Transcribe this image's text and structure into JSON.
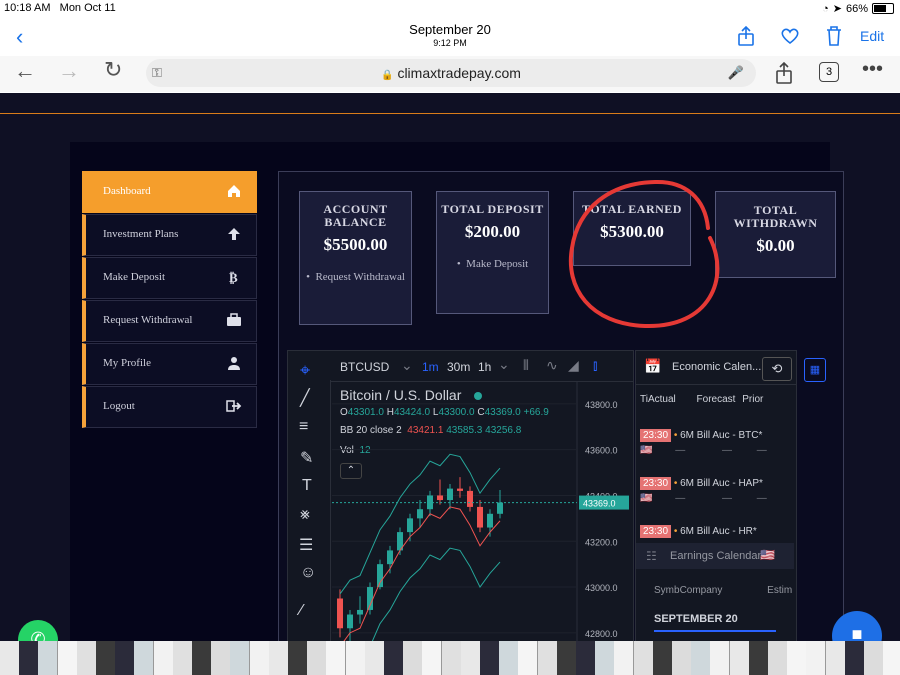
{
  "status_bar": {
    "time": "10:18 AM",
    "date": "Mon Oct 11",
    "battery": "66%",
    "battery_level": 0.66
  },
  "photos_header": {
    "title": "September 20",
    "subtitle": "9:12 PM",
    "edit": "Edit"
  },
  "browser": {
    "url": "climaxtradepay.com",
    "tabs_count": "3"
  },
  "sidebar": {
    "items": [
      {
        "label": "Dashboard",
        "icon": "home-icon"
      },
      {
        "label": "Investment Plans",
        "icon": "arrow-up-icon"
      },
      {
        "label": "Make Deposit",
        "icon": "bitcoin-icon"
      },
      {
        "label": "Request Withdrawal",
        "icon": "briefcase-icon"
      },
      {
        "label": "My Profile",
        "icon": "user-icon"
      },
      {
        "label": "Logout",
        "icon": "logout-icon"
      }
    ]
  },
  "cards": [
    {
      "title": "ACCOUNT BALANCE",
      "value": "$5500.00",
      "link": "Request Withdrawal"
    },
    {
      "title": "TOTAL DEPOSIT",
      "value": "$200.00",
      "link": "Make Deposit"
    },
    {
      "title": "TOTAL EARNED",
      "value": "$5300.00",
      "link": ""
    },
    {
      "title": "TOTAL WITHDRAWN",
      "value": "$0.00",
      "link": ""
    }
  ],
  "chart_widget": {
    "symbol": "BTCUSD",
    "intervals": [
      "1m",
      "30m",
      "1h"
    ],
    "name": "Bitcoin / U.S. Dollar",
    "ohlc": {
      "o": "43301.0",
      "h": "43424.0",
      "l": "43300.0",
      "c": "43369.0",
      "chg": "+66.9"
    },
    "bb": {
      "label": "BB 20 close 2",
      "v1": "43421.1",
      "v2": "43585.3",
      "v3": "43256.8"
    },
    "vol": {
      "label": "Vol",
      "value": "12"
    },
    "price_ticks": [
      "43800.0",
      "43600.0",
      "43400.0",
      "43200.0",
      "43000.0",
      "42800.0"
    ],
    "last_price": "43369.0"
  },
  "chart_data": {
    "type": "candlestick",
    "y_ticks": [
      43800.0,
      43600.0,
      43400.0,
      43200.0,
      43000.0,
      42800.0
    ],
    "last": 43369.0,
    "candles": [
      [
        42950,
        42990,
        42780,
        42820
      ],
      [
        42820,
        42900,
        42760,
        42880
      ],
      [
        42880,
        42960,
        42840,
        42900
      ],
      [
        42900,
        43020,
        42880,
        43000
      ],
      [
        43000,
        43120,
        42990,
        43100
      ],
      [
        43100,
        43180,
        43060,
        43160
      ],
      [
        43160,
        43260,
        43140,
        43240
      ],
      [
        43240,
        43320,
        43200,
        43300
      ],
      [
        43300,
        43380,
        43260,
        43340
      ],
      [
        43340,
        43420,
        43310,
        43400
      ],
      [
        43400,
        43470,
        43360,
        43380
      ],
      [
        43380,
        43450,
        43340,
        43430
      ],
      [
        43430,
        43480,
        43390,
        43420
      ],
      [
        43420,
        43440,
        43330,
        43350
      ],
      [
        43350,
        43380,
        43240,
        43260
      ],
      [
        43260,
        43340,
        43220,
        43320
      ],
      [
        43320,
        43424,
        43300,
        43369
      ]
    ],
    "xlabel": "",
    "ylabel": ""
  },
  "calendar": {
    "title": "Economic Calen...",
    "headers": [
      "Ti",
      "Actual",
      "Forecast",
      "Prior"
    ],
    "rows": [
      {
        "time": "23:30",
        "event": "6M Bill Auc - BTC*"
      },
      {
        "time": "23:30",
        "event": "6M Bill Auc - HAP*"
      },
      {
        "time": "23:30",
        "event": "6M Bill Auc - HR*"
      }
    ],
    "dash": "—",
    "earnings_title": "Earnings Calendar",
    "earnings_headers": [
      "Symb",
      "Company",
      "Estim"
    ],
    "section": "SEPTEMBER 20"
  },
  "colors": {
    "accent": "#f59e2c",
    "page_bg": "#0f1024",
    "up": "#26a69a",
    "down": "#ef5350",
    "annotation": "#e53935"
  }
}
